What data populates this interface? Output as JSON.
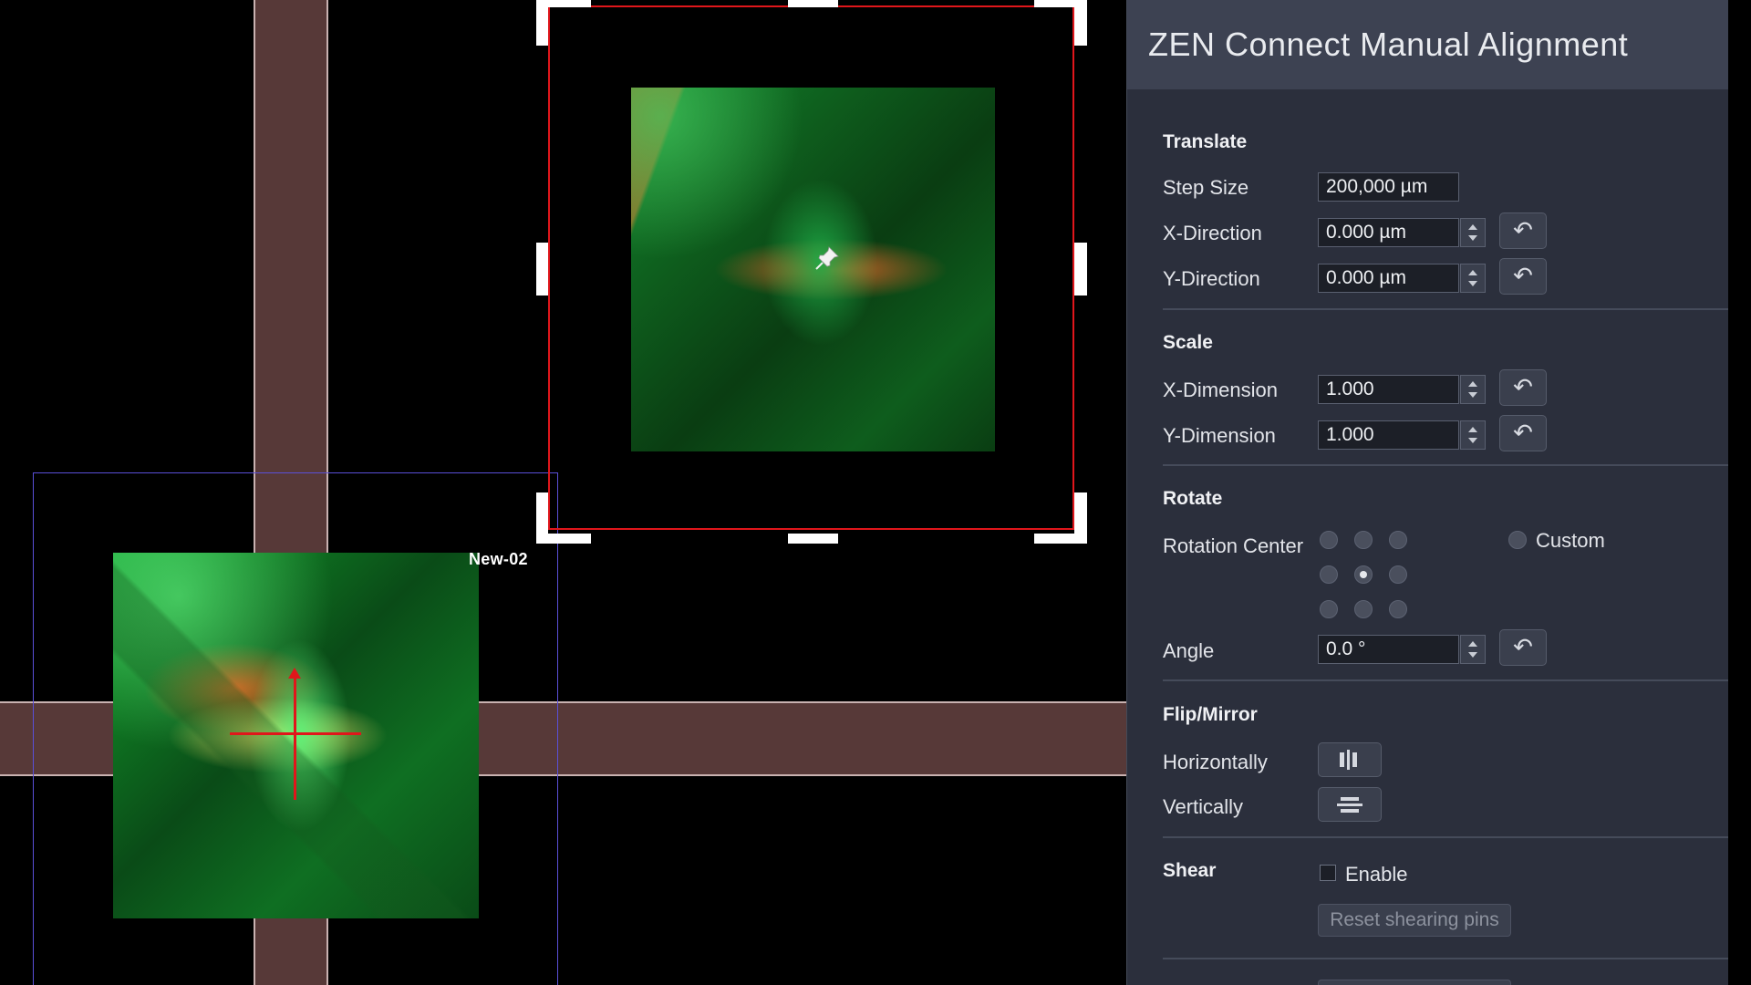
{
  "viewer": {
    "tile_label": "New-02"
  },
  "panel": {
    "title": "ZEN Connect Manual Alignment",
    "translate": {
      "title": "Translate",
      "step_size_label": "Step Size",
      "step_size_value": "200,000 µm",
      "x_label": "X-Direction",
      "x_value": "0.000 µm",
      "y_label": "Y-Direction",
      "y_value": "0.000 µm"
    },
    "scale": {
      "title": "Scale",
      "x_label": "X-Dimension",
      "x_value": "1.000",
      "y_label": "Y-Dimension",
      "y_value": "1.000"
    },
    "rotate": {
      "title": "Rotate",
      "center_label": "Rotation Center",
      "custom_label": "Custom",
      "selected_center": "middle-center",
      "angle_label": "Angle",
      "angle_value": "0.0 °"
    },
    "flip": {
      "title": "Flip/Mirror",
      "horizontal_label": "Horizontally",
      "vertical_label": "Vertically"
    },
    "shear": {
      "title": "Shear",
      "enable_label": "Enable",
      "enable_checked": false,
      "reset_label": "Reset shearing pins"
    },
    "reset_icon": "undo-arrow-icon",
    "colors": {
      "panel_bg": "#2b2f3c",
      "title_bar": "#3d4252",
      "selection": "#e0161b",
      "band": "#573938",
      "frame": "#5a4fd8"
    }
  }
}
